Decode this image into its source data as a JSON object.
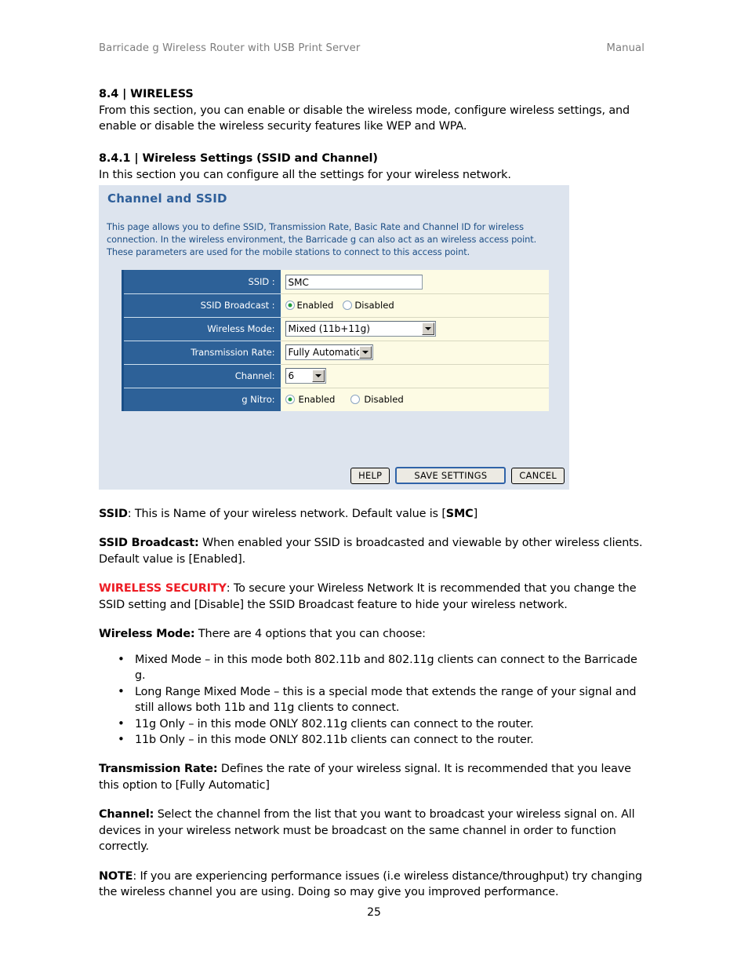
{
  "doc": {
    "header_left": "Barricade g Wireless Router with USB Print Server",
    "header_right": "Manual",
    "page_number": "25"
  },
  "sections": {
    "s84_heading": "8.4 | WIRELESS",
    "s84_body": "From this section, you can enable or disable the wireless mode, configure wireless settings, and enable or disable the wireless security features like WEP and WPA.",
    "s841_heading": "8.4.1 | Wireless Settings (SSID and Channel)",
    "s841_body": "In this section you can configure all the settings for your wireless network."
  },
  "router_panel": {
    "title": "Channel and SSID",
    "description": "This page allows you to define SSID, Transmission Rate, Basic Rate and Channel ID for wireless connection.  In the wireless environment, the Barricade g can also act as an wireless access point.  These parameters are used for the mobile stations to connect to this access point.",
    "rows": {
      "ssid_label": "SSID :",
      "ssid_value": "SMC",
      "ssid_broadcast_label": "SSID Broadcast :",
      "ssid_broadcast_enabled": "Enabled",
      "ssid_broadcast_disabled": "Disabled",
      "wireless_mode_label": "Wireless Mode:",
      "wireless_mode_value": "Mixed (11b+11g)",
      "transmission_rate_label": "Transmission Rate:",
      "transmission_rate_value": "Fully Automatic",
      "channel_label": "Channel:",
      "channel_value": "6",
      "g_nitro_label": "g Nitro:",
      "g_nitro_enabled": "Enabled",
      "g_nitro_disabled": "Disabled"
    },
    "buttons": {
      "help": "HELP",
      "save": "SAVE SETTINGS",
      "cancel": "CANCEL"
    },
    "colors": {
      "panel_bg": "#dde4ee",
      "label_bg": "#2d6198",
      "field_bg": "#fdfbe4",
      "title": "#2e5f9a",
      "description": "#1d4f86",
      "radio_dot": "#1f9b37"
    }
  },
  "descriptions": {
    "ssid_term": "SSID",
    "ssid_text_a": ": This is Name of your wireless network. Default value is [",
    "ssid_default": "SMC",
    "ssid_text_b": "]",
    "broadcast_term": "SSID Broadcast:",
    "broadcast_text": " When enabled your SSID is broadcasted and viewable by other wireless clients. Default value is [Enabled].",
    "security_term": "WIRELESS SECURITY",
    "security_text": ": To secure your Wireless Network It is recommended that you change the SSID setting and [Disable] the SSID Broadcast feature to hide your wireless network.",
    "wireless_mode_term": "Wireless Mode:",
    "wireless_mode_text": " There are 4 options that you can choose:",
    "mode_options": [
      "Mixed Mode – in this mode both 802.11b and 802.11g clients can connect to the Barricade g.",
      "Long Range Mixed Mode – this is a special mode that extends the range of your signal and still allows both 11b and 11g clients to connect.",
      "11g Only – in this mode ONLY 802.11g clients can connect to the router.",
      "11b Only – in this mode ONLY 802.11b clients can connect to the router."
    ],
    "rate_term": "Transmission Rate:",
    "rate_text": " Defines the rate of your wireless signal. It is recommended that you leave this option to [Fully Automatic]",
    "channel_term": "Channel:",
    "channel_text": " Select the channel from the list that you want to broadcast your wireless signal on. All devices in your wireless network must be broadcast on the same channel in order to function correctly.",
    "note_term": "NOTE",
    "note_text": ": If you are experiencing performance issues (i.e wireless distance/throughput) try changing the wireless channel you are using. Doing so may give you improved performance."
  }
}
